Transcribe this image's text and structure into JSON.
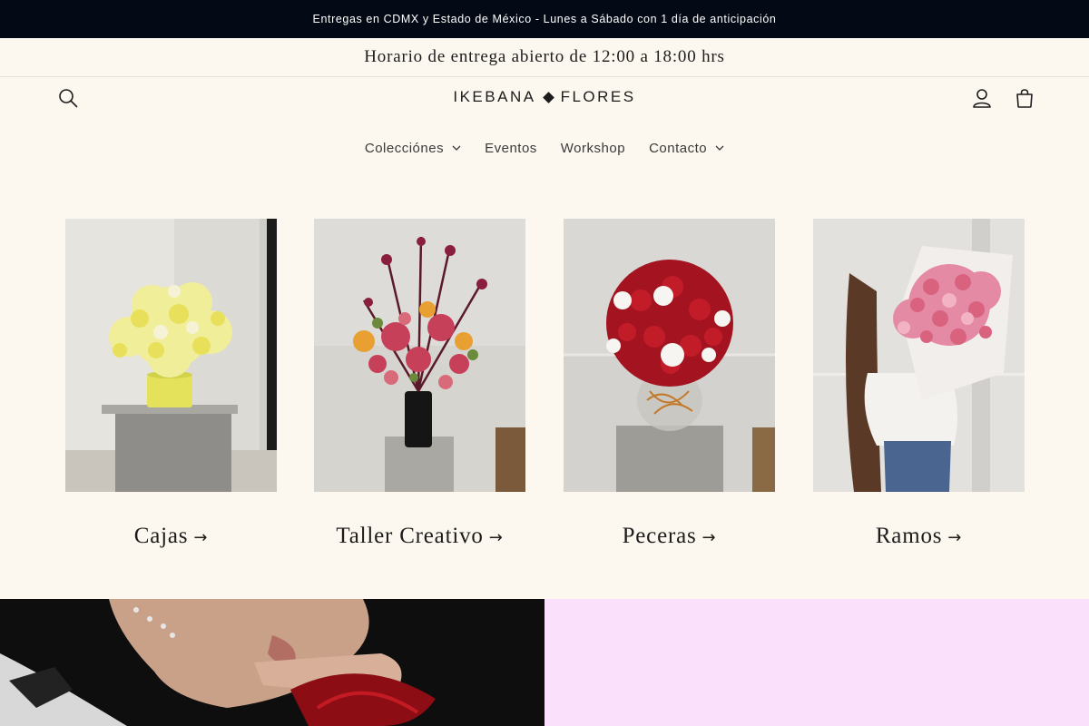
{
  "announcement": "Entregas en CDMX y Estado de México - Lunes a Sábado con 1 día de anticipación",
  "hours_banner": "Horario de entrega abierto de 12:00 a 18:00 hrs",
  "header": {
    "logo_left": "IKEBANA",
    "logo_right": "FLORES",
    "icons": {
      "search": "search-icon",
      "account": "user-icon",
      "cart": "shopping-bag-icon"
    }
  },
  "nav": [
    {
      "label": "Colecciónes",
      "has_dropdown": true
    },
    {
      "label": "Eventos",
      "has_dropdown": false
    },
    {
      "label": "Workshop",
      "has_dropdown": false
    },
    {
      "label": "Contacto",
      "has_dropdown": true
    }
  ],
  "collections": [
    {
      "title": "Cajas",
      "arrow": "→"
    },
    {
      "title": "Taller Creativo",
      "arrow": "→"
    },
    {
      "title": "Peceras",
      "arrow": "→"
    },
    {
      "title": "Ramos",
      "arrow": "→"
    }
  ],
  "colors": {
    "announcement_bg": "#030a15",
    "page_bg": "#fdf8ef",
    "banner_pink": "#fae0fa",
    "banner_dark": "#0e0e0e"
  }
}
